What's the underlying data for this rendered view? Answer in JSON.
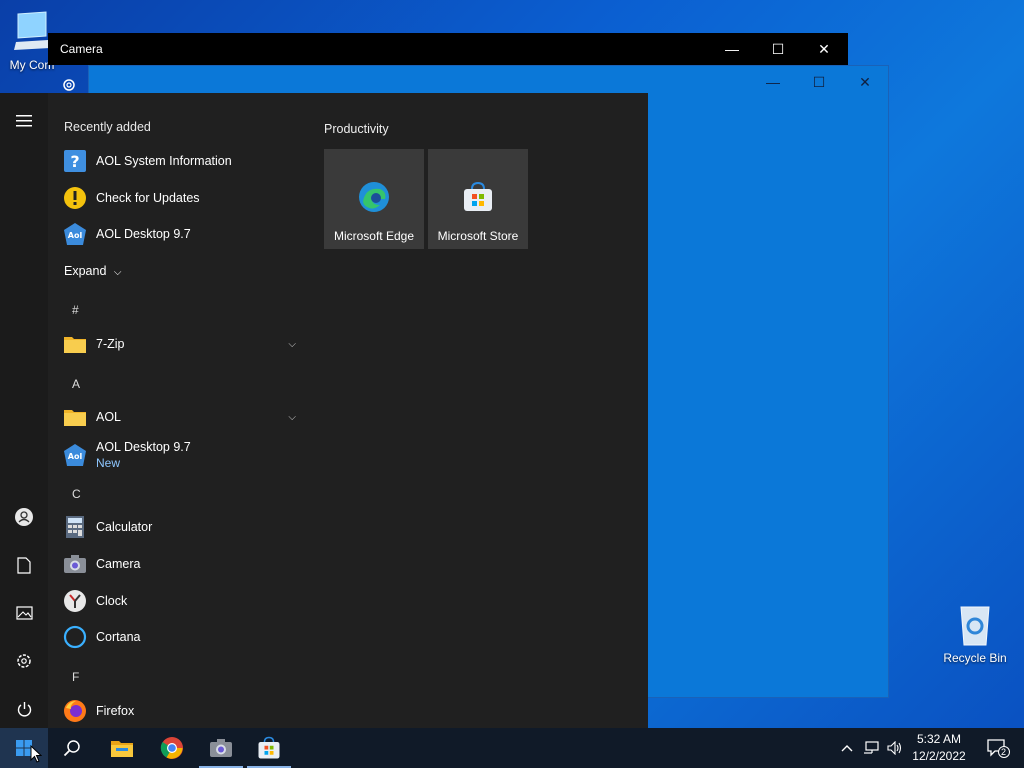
{
  "desktop": {
    "icons": [
      {
        "label": "My Com",
        "icon": "computer-icon"
      },
      {
        "label": "Recycle Bin",
        "icon": "recycle-bin-icon"
      }
    ]
  },
  "camera_window": {
    "title": "Camera"
  },
  "start_menu": {
    "recently_added_header": "Recently added",
    "recent": [
      {
        "label": "AOL System Information",
        "icon": "aol-system-info-icon"
      },
      {
        "label": "Check for Updates",
        "icon": "warning-icon"
      },
      {
        "label": "AOL Desktop 9.7",
        "icon": "aol-icon"
      }
    ],
    "expand_label": "Expand",
    "groups": [
      {
        "letter": "#",
        "items": [
          {
            "label": "7-Zip",
            "icon": "folder-icon",
            "expandable": true
          }
        ]
      },
      {
        "letter": "A",
        "items": [
          {
            "label": "AOL",
            "icon": "folder-icon",
            "expandable": true
          },
          {
            "label": "AOL Desktop 9.7",
            "sub": "New",
            "icon": "aol-icon"
          }
        ]
      },
      {
        "letter": "C",
        "items": [
          {
            "label": "Calculator",
            "icon": "calculator-icon"
          },
          {
            "label": "Camera",
            "icon": "camera-icon"
          },
          {
            "label": "Clock",
            "icon": "clock-icon"
          },
          {
            "label": "Cortana",
            "icon": "cortana-icon"
          }
        ]
      },
      {
        "letter": "F",
        "items": [
          {
            "label": "Firefox",
            "icon": "firefox-icon"
          }
        ]
      }
    ],
    "tiles_header": "Productivity",
    "tiles": [
      {
        "label": "Microsoft Edge",
        "icon": "edge-icon"
      },
      {
        "label": "Microsoft Store",
        "icon": "store-icon"
      }
    ]
  },
  "taskbar": {
    "apps": [
      "start-icon",
      "search-icon",
      "file-explorer-icon",
      "chrome-icon",
      "camera-icon",
      "store-icon"
    ],
    "time": "5:32 AM",
    "date": "12/2/2022",
    "notification_count": "2"
  }
}
